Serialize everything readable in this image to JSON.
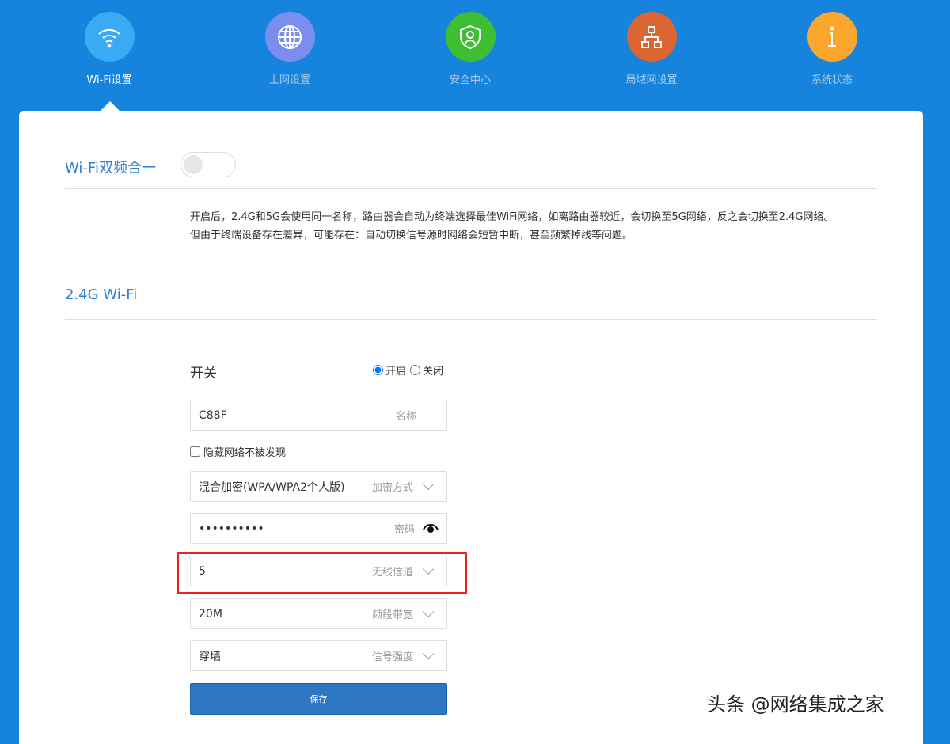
{
  "nav": {
    "items": [
      {
        "label": "Wi-Fi设置",
        "icon": "wifi-icon",
        "color": "#3aabf2"
      },
      {
        "label": "上网设置",
        "icon": "globe-icon",
        "color": "#7b8ef0"
      },
      {
        "label": "安全中心",
        "icon": "shield-user-icon",
        "color": "#3fbe34"
      },
      {
        "label": "局域网设置",
        "icon": "network-icon",
        "color": "#dc6632"
      },
      {
        "label": "系统状态",
        "icon": "info-icon",
        "color": "#fba62c"
      }
    ]
  },
  "dual_band": {
    "title": "Wi-Fi双频合一",
    "enabled": false,
    "desc1": "开启后，2.4G和5G会使用同一名称，路由器会自动为终端选择最佳WiFi网络，如离路由器较近，会切换至5G网络，反之会切换至2.4G网络。",
    "desc2": "但由于终端设备存在差异，可能存在：自动切换信号源时网络会短暂中断，甚至频繁掉线等问题。"
  },
  "wifi24": {
    "title": "2.4G Wi-Fi",
    "switch_label": "开关",
    "on_label": "开启",
    "off_label": "关闭",
    "name_value": "C88F",
    "name_label": "名称",
    "hide_label": "隐藏网络不被发现",
    "enc_value": "混合加密(WPA/WPA2个人版)",
    "enc_label": "加密方式",
    "pwd_value": "••••••••••",
    "pwd_label": "密码",
    "channel_value": "5",
    "channel_label": "无线信道",
    "bw_value": "20M",
    "bw_label": "频段带宽",
    "power_value": "穿墙",
    "power_label": "信号强度",
    "save_label": "保存"
  },
  "watermark": "头条 @网络集成之家"
}
